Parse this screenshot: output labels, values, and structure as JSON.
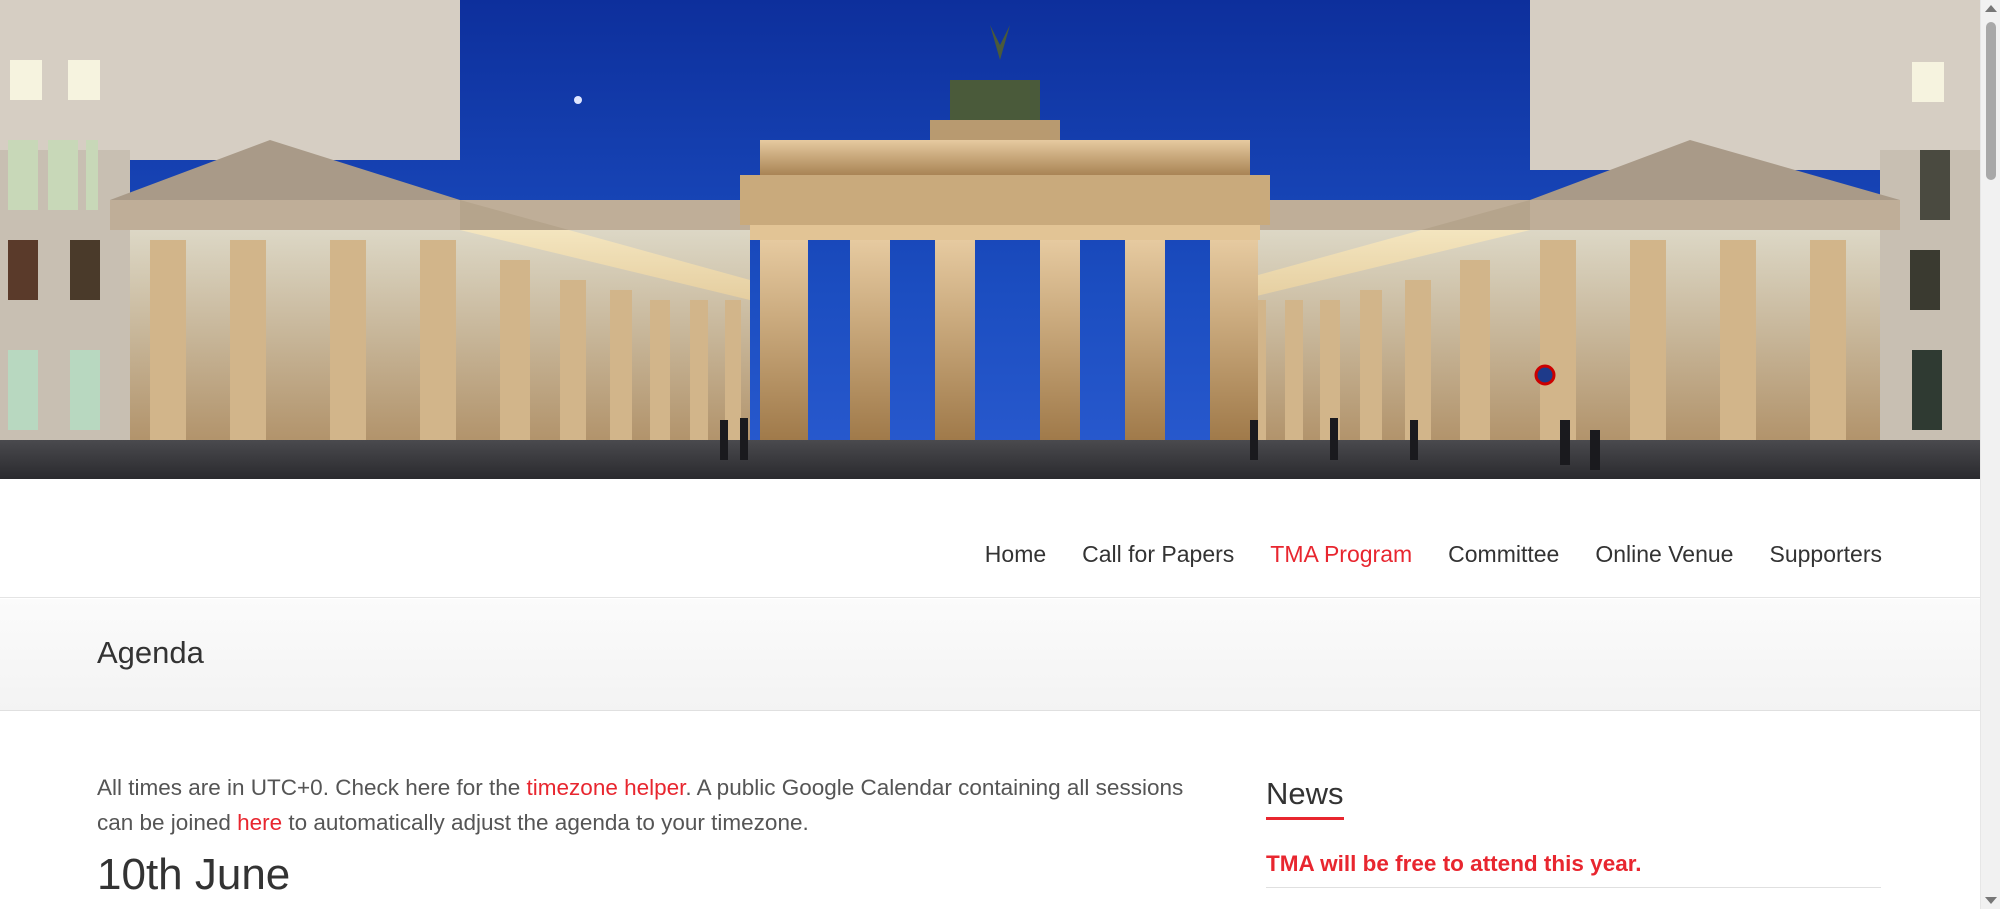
{
  "hero": {
    "image_alt": "Brandenburg Gate at night"
  },
  "nav": {
    "items": [
      {
        "label": "Home",
        "active": false
      },
      {
        "label": "Call for Papers",
        "active": false
      },
      {
        "label": "TMA Program",
        "active": true
      },
      {
        "label": "Committee",
        "active": false
      },
      {
        "label": "Online Venue",
        "active": false
      },
      {
        "label": "Supporters",
        "active": false
      }
    ]
  },
  "page_title": "Agenda",
  "intro": {
    "text_1": "All times are in UTC+0. Check here for the ",
    "link_1": "timezone helper",
    "text_2": ". A public Google Calendar containing all sessions can be joined ",
    "link_2": "here",
    "text_3": " to automatically adjust the agenda to your timezone."
  },
  "day_heading": "10th June",
  "sidebar": {
    "heading": "News",
    "news_item": "TMA will be free to attend this year."
  },
  "colors": {
    "accent": "#e8262f",
    "sky": "#1d44a8",
    "text": "#555555"
  }
}
